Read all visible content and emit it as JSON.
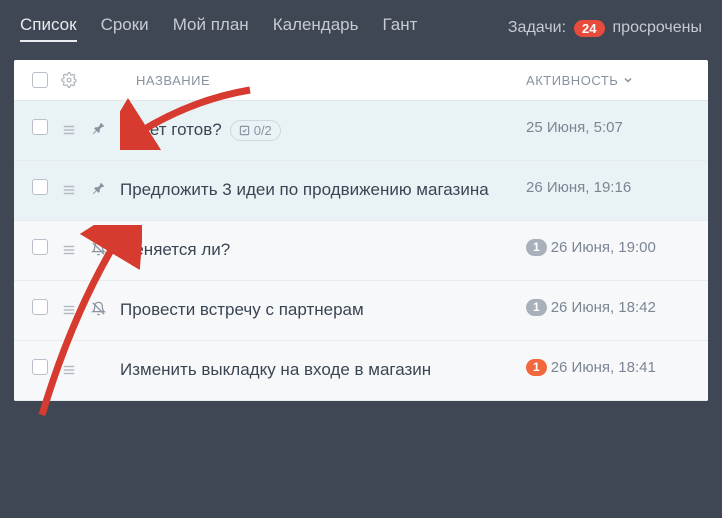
{
  "tabs": [
    {
      "label": "Список",
      "active": true
    },
    {
      "label": "Сроки",
      "active": false
    },
    {
      "label": "Мой план",
      "active": false
    },
    {
      "label": "Календарь",
      "active": false
    },
    {
      "label": "Гант",
      "active": false
    }
  ],
  "status": {
    "prefix": "Задачи:",
    "count": "24",
    "suffix": "просрочены"
  },
  "headers": {
    "title": "НАЗВАНИЕ",
    "activity": "АКТИВНОСТЬ"
  },
  "rows": [
    {
      "pinned": true,
      "icon": "pin",
      "title": "Отчет готов?",
      "subtasks": "0/2",
      "activity": "25 Июня, 5:07",
      "count": null,
      "count_color": null
    },
    {
      "pinned": true,
      "icon": "pin",
      "title": "Предложить 3 идеи по продвижению магазина",
      "subtasks": null,
      "activity": "26 Июня, 19:16",
      "count": null,
      "count_color": null
    },
    {
      "pinned": false,
      "icon": "bell-off",
      "title": "Меняется ли?",
      "subtasks": null,
      "activity": "26 Июня, 19:00",
      "count": "1",
      "count_color": "gray"
    },
    {
      "pinned": false,
      "icon": "bell-off",
      "title": "Провести встречу с партнерам",
      "subtasks": null,
      "activity": "26 Июня, 18:42",
      "count": "1",
      "count_color": "gray"
    },
    {
      "pinned": false,
      "icon": null,
      "title": "Изменить выкладку на входе в магазин",
      "subtasks": null,
      "activity": "26 Июня, 18:41",
      "count": "1",
      "count_color": "orange"
    }
  ]
}
